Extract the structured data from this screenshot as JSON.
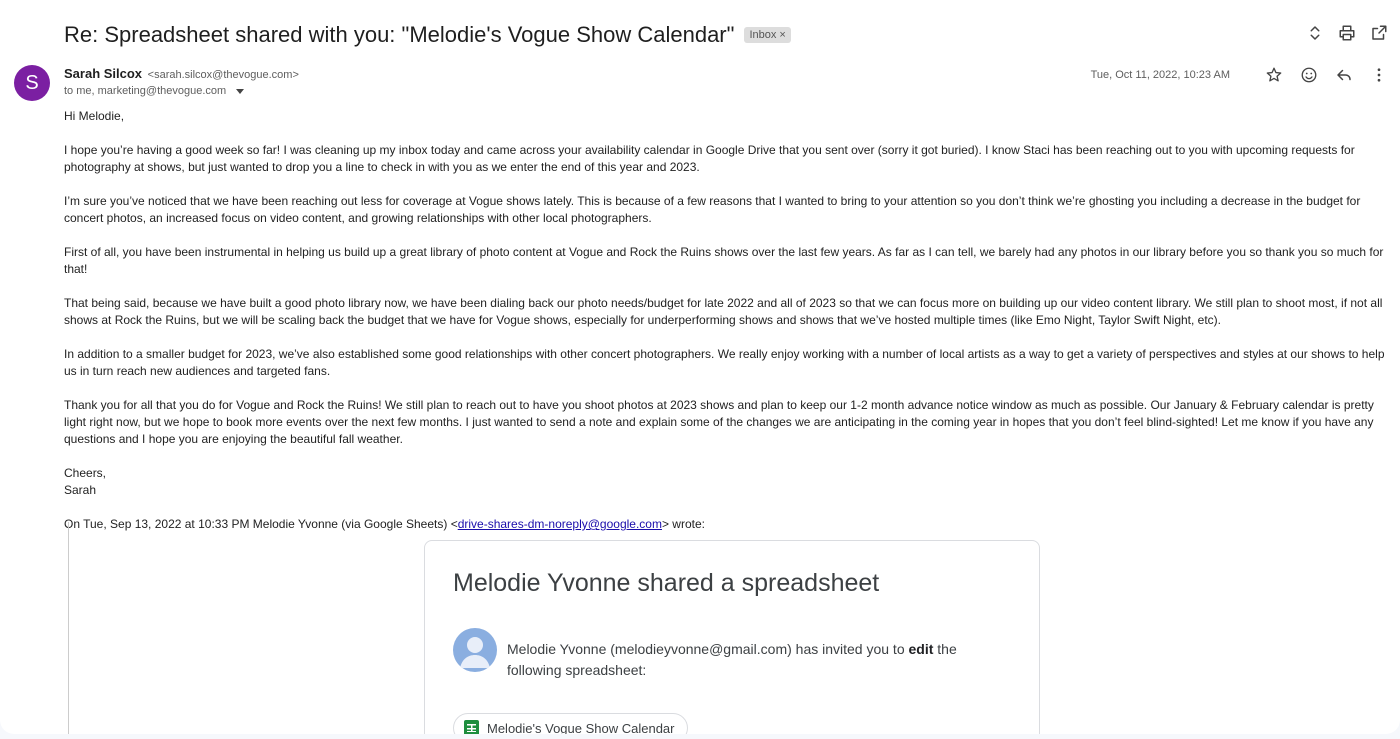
{
  "email": {
    "subject": "Re: Spreadsheet shared with you: \"Melodie's Vogue Show Calendar\"",
    "label": "Inbox",
    "label_remove": "×",
    "sender_name": "Sarah Silcox",
    "sender_email": "<sarah.silcox@thevogue.com>",
    "avatar_letter": "S",
    "recipients": "to me, marketing@thevogue.com",
    "date": "Tue, Oct 11, 2022, 10:23 AM"
  },
  "icons": {
    "expand": "unfold-icon",
    "print": "print-icon",
    "open_new": "open-in-new-icon",
    "star": "star-icon",
    "emoji": "emoji-icon",
    "reply": "reply-icon",
    "more": "more-vert-icon"
  },
  "body": {
    "greeting": "Hi Melodie,",
    "p1": "I hope you’re having a good week so far! I was cleaning up my inbox today and came across your availability calendar in Google Drive that you sent over (sorry it got buried). I know Staci has been reaching out to you with upcoming requests for photography at shows, but just wanted to drop you a line to check in with you as we enter the end of this year and 2023.",
    "p2": "I’m sure you’ve noticed that we have been reaching out less for coverage at Vogue shows lately. This is because of a few reasons that I wanted to bring to your attention so you don’t think we’re ghosting you including a decrease in the budget for concert photos, an increased focus on video content, and growing relationships with other local photographers.",
    "p3": "First of all, you have been instrumental in helping us build up a great library of photo content at Vogue and Rock the Ruins shows over the last few years. As far as I can tell, we barely had any photos in our library before you so thank you so much for that!",
    "p4": "That being said, because we have built a good photo library now, we have been dialing back our photo needs/budget for late 2022 and all of 2023 so that we can focus more on building up our video content library. We still plan to shoot most, if not all shows at Rock the Ruins, but we will be scaling back the budget that we have for Vogue shows, especially for underperforming shows and shows that we’ve hosted multiple times (like Emo Night, Taylor Swift Night, etc).",
    "p5": "In addition to a smaller budget for 2023, we’ve also established some good relationships with other concert photographers. We really enjoy working with a number of local artists as a way to get a variety of perspectives and styles at our shows to help us in turn reach new audiences and targeted fans.",
    "p6": "Thank you for all that you do for Vogue and Rock the Ruins! We still plan to reach out to have you shoot photos at 2023 shows and plan to keep our 1-2 month advance notice window as much as possible. Our January & February calendar is pretty light right now, but we hope to book more events over the next few months. I just wanted to send a note and explain some of the changes we are anticipating in the coming year in hopes that you don’t feel blind-sighted! Let me know if you have any questions and I hope you are enjoying the beautiful fall weather.",
    "signoff": "Cheers,",
    "signature": "Sarah",
    "quote_intro": "On Tue, Sep 13, 2022 at 10:33 PM Melodie Yvonne (via Google Sheets) <",
    "quote_link": "drive-shares-dm-noreply@google.com",
    "quote_outro": "> wrote:"
  },
  "share_card": {
    "title": "Melodie Yvonne shared a spreadsheet",
    "invite_prefix": "Melodie Yvonne (melodieyvonne@gmail.com) has invited you to ",
    "invite_role": "edit",
    "invite_suffix": " the following spreadsheet:",
    "file_name": "Melodie's Vogue Show Calendar"
  }
}
